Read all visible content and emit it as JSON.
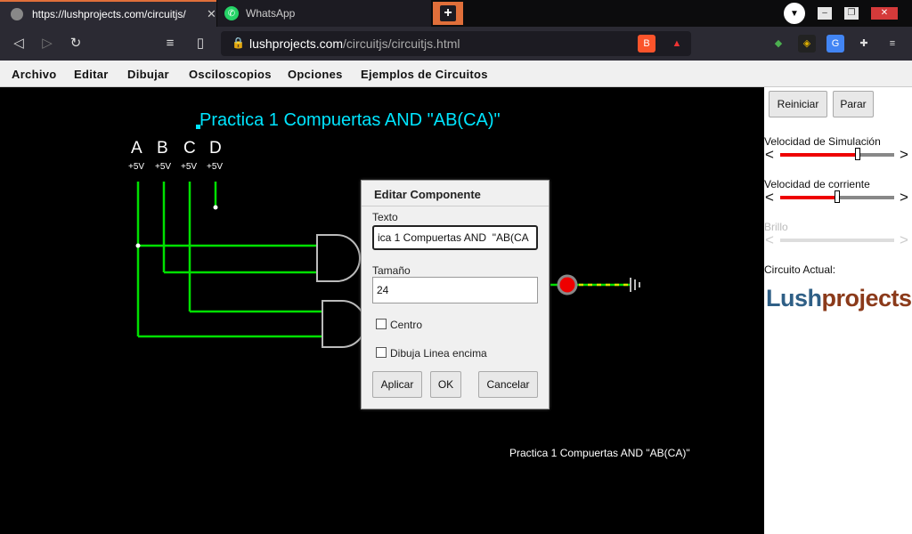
{
  "browser": {
    "tabs": [
      {
        "title": "https://lushprojects.com/circuitjs/",
        "close": "✕"
      },
      {
        "title": "WhatsApp"
      }
    ],
    "new_tab": "+",
    "url_host": "lushprojects.com",
    "url_path": "/circuitjs/circuitjs.html"
  },
  "menu": {
    "items": [
      "Archivo",
      "Editar",
      "Dibujar",
      "Osciloscopios",
      "Opciones",
      "Ejemplos de Circuitos"
    ]
  },
  "canvas": {
    "title": "Practica 1 Compuertas AND  \"AB(CA)\"",
    "bottom_text": "Practica 1 Compuertas AND  \"AB(CA)\"",
    "inputs": [
      {
        "letter": "A",
        "volt": "+5V"
      },
      {
        "letter": "B",
        "volt": "+5V"
      },
      {
        "letter": "C",
        "volt": "+5V"
      },
      {
        "letter": "D",
        "volt": "+5V"
      }
    ]
  },
  "dialog": {
    "title": "Editar Componente",
    "texto_label": "Texto",
    "texto_value": "ica 1 Compuertas AND  \"AB(CA",
    "tamano_label": "Tamaño",
    "tamano_value": "24",
    "centro_label": "Centro",
    "linea_label": "Dibuja Linea encima",
    "apply": "Aplicar",
    "ok": "OK",
    "cancel": "Cancelar"
  },
  "panel": {
    "reset": "Reiniciar",
    "stop": "Parar",
    "sim_speed_label": "Velocidad de Simulación",
    "sim_speed": 0.68,
    "current_speed_label": "Velocidad de corriente",
    "current_speed": 0.5,
    "brightness_label": "Brillo",
    "circuit_label": "Circuito Actual:",
    "logo_a": "Lush",
    "logo_b": "projects"
  },
  "colors": {
    "wire_active": "#00e000",
    "title_cyan": "#00e5ff",
    "slider_fill": "#e00000",
    "accent_tab": "#e06f3a"
  }
}
